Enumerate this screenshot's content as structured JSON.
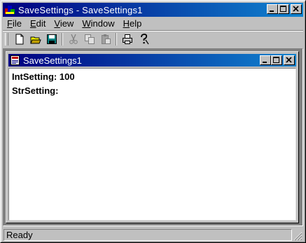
{
  "window": {
    "title": "SaveSettings - SaveSettings1",
    "app_icon": "mfc-app-icon"
  },
  "menu": [
    {
      "label": "File",
      "accel": "F"
    },
    {
      "label": "Edit",
      "accel": "E"
    },
    {
      "label": "View",
      "accel": "V"
    },
    {
      "label": "Window",
      "accel": "W"
    },
    {
      "label": "Help",
      "accel": "H"
    }
  ],
  "toolbar": {
    "buttons": [
      "new-icon",
      "open-icon",
      "save-icon",
      "cut-icon",
      "copy-icon",
      "paste-icon",
      "print-icon",
      "help-icon"
    ]
  },
  "child_window": {
    "title": "SaveSettings1",
    "content": {
      "line1": "IntSetting: 100",
      "line2": "StrSetting:"
    }
  },
  "status": {
    "text": "Ready"
  },
  "colors": {
    "title_active": "#000080",
    "title_gradient_end": "#1084d0",
    "face": "#c0c0c0"
  }
}
